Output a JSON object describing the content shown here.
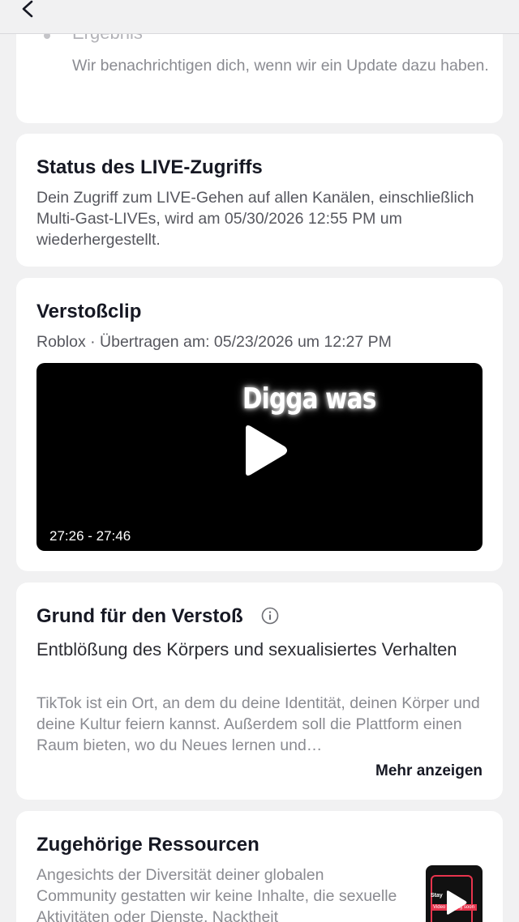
{
  "nav": {
    "back_icon": "chevron-left-icon"
  },
  "update_card": {
    "step_label": "Ergebnis",
    "step_description": "Wir benachrichtigen dich, wenn wir ein Update dazu haben."
  },
  "status_card": {
    "title": "Status des LIVE-Zugriffs",
    "text": "Dein Zugriff zum LIVE-Gehen auf allen Kanälen, einschließlich Multi-Gast-LIVEs, wird am 05/30/2026 12:55 PM um wiederhergestellt."
  },
  "clip_card": {
    "title": "Verstoßclip",
    "meta": "Roblox · Übertragen am: 05/23/2026 um 12:27 PM",
    "video_caption": "Digga was",
    "video_time_range": "27:26 - 27:46",
    "play_icon": "play-icon"
  },
  "reason_card": {
    "title": "Grund für den Verstoß",
    "info_icon": "info-icon",
    "headline": "Entblößung des Körpers und sexualisiertes Verhalten",
    "description": "TikTok ist ein Ort, an dem du deine Identität, deinen Körper und deine Kultur feiern kannst. Außerdem soll die Plattform einen Raum bieten, wo du Neues lernen und…",
    "more_label": "Mehr anzeigen"
  },
  "resources_card": {
    "title": "Zugehörige Ressourcen",
    "description": "Angesichts der Diversität deiner globalen Community gestatten wir keine Inhalte, die sexuelle Aktivitäten oder Dienste. Nacktheit",
    "thumb_text_1": "Stay",
    "thumb_text_2": "Video coming soon"
  },
  "colors": {
    "background": "#f1f1f2",
    "card": "#ffffff",
    "text_primary": "#161823",
    "text_secondary": "#56575e",
    "text_muted": "#8a8b91",
    "accent": "#e8344d"
  }
}
